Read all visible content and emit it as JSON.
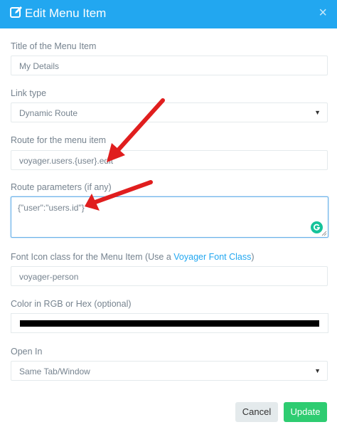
{
  "modal": {
    "title": "Edit Menu Item",
    "close_glyph": "×",
    "icon": "edit-icon"
  },
  "fields": {
    "title_label": "Title of the Menu Item",
    "title_value": "My Details",
    "link_type_label": "Link type",
    "link_type_value": "Dynamic Route",
    "route_label": "Route for the menu item",
    "route_value": "voyager.users.{user}.edit",
    "params_label": "Route parameters (if any)",
    "params_value": "{\"user\":\"users.id\"}",
    "icon_label_prefix": "Font Icon class for the Menu Item (Use a ",
    "icon_label_link": "Voyager Font Class",
    "icon_label_suffix": ")",
    "icon_value": "voyager-person",
    "color_label": "Color in RGB or Hex (optional)",
    "color_value_hex": "#000000",
    "open_in_label": "Open In",
    "open_in_value": "Same Tab/Window"
  },
  "buttons": {
    "cancel": "Cancel",
    "update": "Update"
  },
  "colors": {
    "header": "#22a7f0",
    "update_button": "#2ecc71",
    "cancel_button": "#e4eaec",
    "annotation_arrow": "#e01e1e",
    "grammarly": "#15c39a"
  }
}
